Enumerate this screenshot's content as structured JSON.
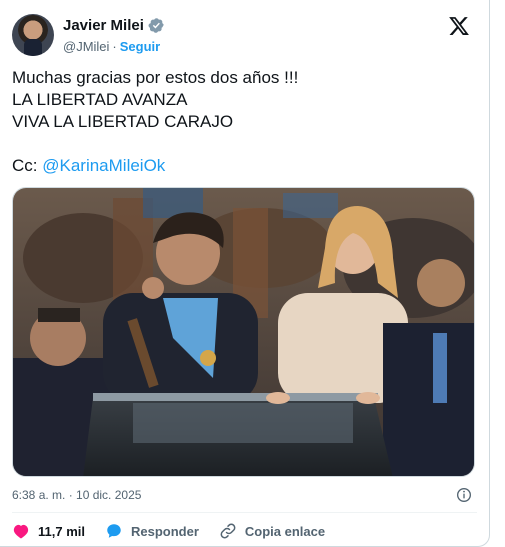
{
  "author": {
    "name": "Javier Milei",
    "handle": "@JMilei",
    "separator": "·",
    "follow_label": "Seguir",
    "verified": true
  },
  "tweet": {
    "lines": [
      "Muchas gracias por estos dos años !!!",
      "LA LIBERTAD AVANZA",
      "VIVA LA LIBERTAD CARAJO"
    ],
    "cc_prefix": "Cc: ",
    "cc_mention": "@KarinaMileiOk"
  },
  "timestamp": "6:38 a. m. · 10 dic. 2025",
  "actions": {
    "likes": "11,7 mil",
    "reply_label": "Responder",
    "copy_label": "Copia enlace"
  },
  "colors": {
    "accent": "#1d9bf0",
    "like": "#f91880",
    "muted": "#536471",
    "text": "#0f1419"
  },
  "icons": [
    "verified-badge-icon",
    "x-logo-icon",
    "info-icon",
    "heart-icon",
    "reply-bubble-icon",
    "link-icon"
  ]
}
